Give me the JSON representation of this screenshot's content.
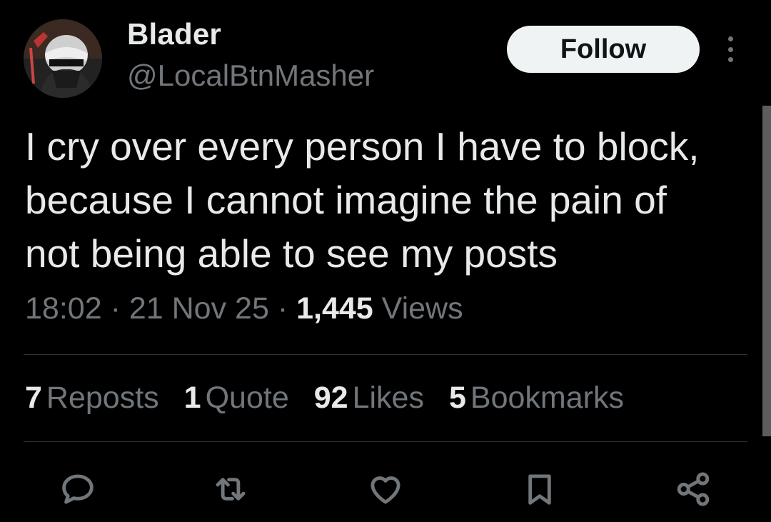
{
  "user": {
    "display_name": "Blader",
    "handle": "@LocalBtnMasher"
  },
  "follow_label": "Follow",
  "tweet": {
    "text": "I cry over every person I have to block,\nbecause I cannot imagine the pain of\nnot being able to see my posts",
    "time": "18:02",
    "date": "21 Nov 25",
    "views_count": "1,445",
    "views_label": "Views",
    "separator": "·"
  },
  "stats": [
    {
      "count": "7",
      "label": "Reposts"
    },
    {
      "count": "1",
      "label": "Quote"
    },
    {
      "count": "92",
      "label": "Likes"
    },
    {
      "count": "5",
      "label": "Bookmarks"
    }
  ],
  "actions": [
    "reply-icon",
    "repost-icon",
    "like-icon",
    "bookmark-icon",
    "share-icon"
  ],
  "colors": {
    "background": "#000000",
    "primary_text": "#e7e9ea",
    "secondary_text": "#71767b",
    "divider": "#2f3336",
    "follow_bg": "#eff3f4"
  }
}
